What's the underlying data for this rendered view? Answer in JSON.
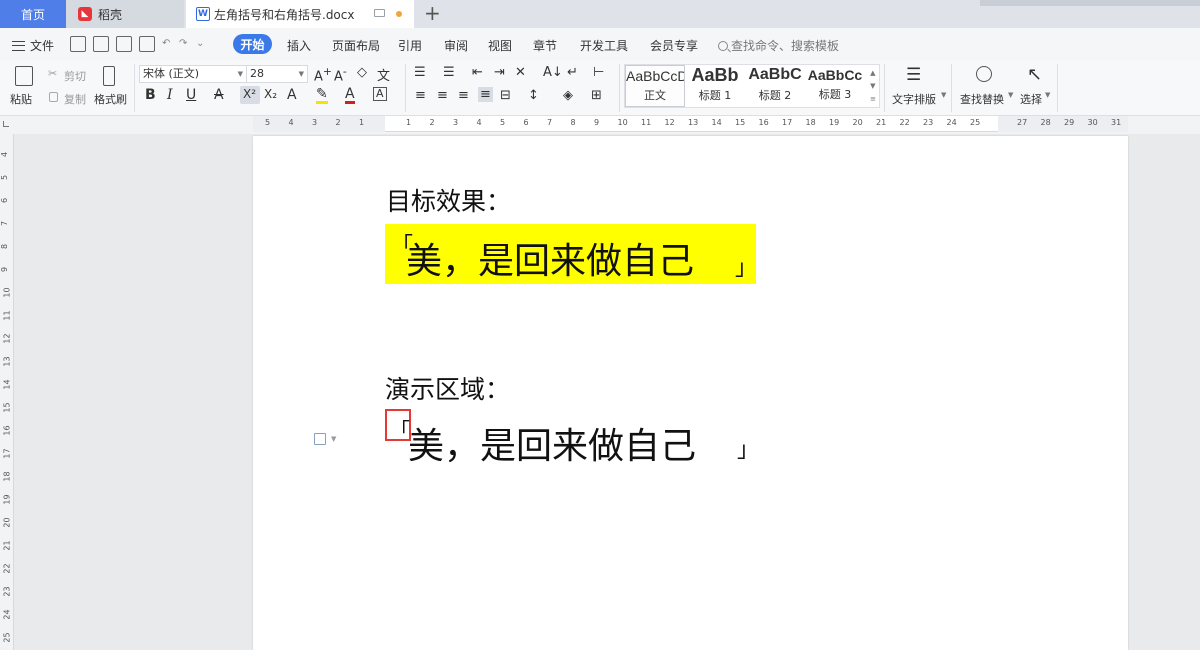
{
  "tabs": {
    "home": "首页",
    "daoke": "稻壳",
    "document": "左角括号和右角括号.docx",
    "add": "+"
  },
  "menu": {
    "file": "文件",
    "items": [
      "开始",
      "插入",
      "页面布局",
      "引用",
      "审阅",
      "视图",
      "章节",
      "开发工具",
      "会员专享"
    ],
    "search_placeholder": "查找命令、搜索模板"
  },
  "ribbon": {
    "paste": "粘贴",
    "cut": "剪切",
    "copy": "复制",
    "format_painter": "格式刷",
    "font_name": "宋体 (正文)",
    "font_size": "28",
    "styles": [
      {
        "sample": "AaBbCcDd",
        "name": "正文"
      },
      {
        "sample": "AaBb",
        "name": "标题 1"
      },
      {
        "sample": "AaBbC",
        "name": "标题 2"
      },
      {
        "sample": "AaBbCc",
        "name": "标题 3"
      }
    ],
    "text_layout": "文字排版",
    "find_replace": "查找替换",
    "select": "选择"
  },
  "ruler": {
    "h_numbers": [
      "5",
      "4",
      "3",
      "2",
      "1",
      "",
      "1",
      "2",
      "3",
      "4",
      "5",
      "6",
      "7",
      "8",
      "9",
      "10",
      "11",
      "12",
      "13",
      "14",
      "15",
      "16",
      "17",
      "18",
      "19",
      "20",
      "21",
      "22",
      "23",
      "24",
      "25",
      "",
      "27",
      "28",
      "29",
      "30",
      "31"
    ],
    "v_numbers": [
      "4",
      "5",
      "6",
      "7",
      "8",
      "9",
      "10",
      "11",
      "12",
      "13",
      "14",
      "15",
      "16",
      "17",
      "18",
      "19",
      "20",
      "21",
      "22",
      "23",
      "24",
      "25"
    ]
  },
  "document": {
    "target_heading": "目标效果：",
    "target_text": "美，是回来做自己",
    "demo_heading": "演示区域：",
    "demo_text": "美，是回来做自己",
    "left_bracket": "「",
    "right_bracket": "」",
    "highlight_color": "#ffff00"
  }
}
